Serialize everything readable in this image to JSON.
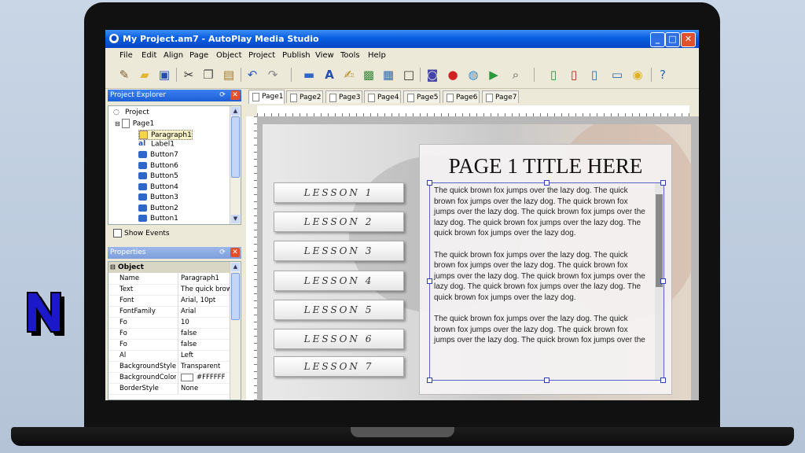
{
  "window": {
    "title": "My Project.am7 - AutoPlay Media Studio",
    "app_icon": "autoplay-logo-icon",
    "controls": [
      "minimize",
      "maximize",
      "close"
    ]
  },
  "menu": [
    "File",
    "Edit",
    "Align",
    "Page",
    "Object",
    "Project",
    "Publish",
    "View",
    "Tools",
    "Help"
  ],
  "toolbar": {
    "icons": [
      "wand-icon",
      "open-folder-icon",
      "save-icon",
      "cut-icon",
      "copy-icon",
      "paste-icon",
      "undo-icon",
      "redo-icon",
      "button-object-icon",
      "label-object-icon",
      "paragraph-object-icon",
      "image-object-icon",
      "grid-object-icon",
      "frame-object-icon",
      "video-object-icon",
      "flash-object-icon",
      "web-object-icon",
      "publish-icon",
      "search-icon",
      "add-page-icon",
      "page-icon",
      "page-preview-icon",
      "computer-icon",
      "cd-icon",
      "help-icon"
    ]
  },
  "project_explorer": {
    "title": "Project Explorer",
    "items": [
      {
        "label": "Project",
        "icon": "project-icon"
      },
      {
        "label": "Page1",
        "icon": "page-icon"
      },
      {
        "label": "Paragraph1",
        "icon": "paragraph-icon"
      },
      {
        "label": "Label1",
        "icon": "label-icon"
      },
      {
        "label": "Button7",
        "icon": "button-icon"
      },
      {
        "label": "Button6",
        "icon": "button-icon"
      },
      {
        "label": "Button5",
        "icon": "button-icon"
      },
      {
        "label": "Button4",
        "icon": "button-icon"
      },
      {
        "label": "Button3",
        "icon": "button-icon"
      },
      {
        "label": "Button2",
        "icon": "button-icon"
      },
      {
        "label": "Button1",
        "icon": "button-icon"
      }
    ],
    "show_events": "Show Events"
  },
  "properties": {
    "title": "Properties",
    "section": "Object",
    "rows": [
      {
        "key": "Name",
        "value": "Paragraph1"
      },
      {
        "key": "Text",
        "value": "The quick brown"
      },
      {
        "key": "Font",
        "value": "Arial, 10pt"
      },
      {
        "key": "FontFamily",
        "value": "Arial"
      },
      {
        "key": "Fo",
        "value": "10"
      },
      {
        "key": "Fo",
        "value": "false"
      },
      {
        "key": "Fo",
        "value": "false"
      },
      {
        "key": "Al",
        "value": "Left"
      },
      {
        "key": "BackgroundStyle",
        "value": "Transparent"
      },
      {
        "key": "BackgroundColor",
        "value": "#FFFFFF",
        "swatch": "#ffffff"
      },
      {
        "key": "BorderStyle",
        "value": "None"
      }
    ]
  },
  "tabs": [
    "Page1",
    "Page2",
    "Page3",
    "Page4",
    "Page5",
    "Page6",
    "Page7"
  ],
  "active_tab": "Page1",
  "canvas": {
    "lessons": [
      "LESSON 1",
      "LESSON 2",
      "LESSON 3",
      "LESSON 4",
      "LESSON 5",
      "LESSON 6",
      "LESSON 7"
    ],
    "page_title": "PAGE 1 TITLE HERE",
    "paragraphs": [
      "The quick brown fox jumps over the lazy dog. The quick brown fox jumps over the lazy dog. The quick brown fox jumps over the lazy dog. The quick brown fox jumps over the lazy dog. The quick brown fox jumps over the lazy dog. The quick brown fox jumps over the lazy dog.",
      "The quick brown fox jumps over the lazy dog. The quick brown fox jumps over the lazy dog. The quick brown fox jumps over the lazy dog. The quick brown fox jumps over the lazy dog. The quick brown fox jumps over the lazy dog. The quick brown fox jumps over the lazy dog.",
      "The quick brown fox jumps over the lazy dog. The quick brown fox jumps over the lazy dog. The quick brown fox jumps over the lazy dog. The quick brown fox jumps over the"
    ]
  },
  "colors": {
    "titlebar": "#0a5ee0",
    "panel_header": "#1d5fd6",
    "selection_border": "#5a64c8",
    "logo_fill": "#1a18c8"
  },
  "logo": {
    "letter": "N"
  }
}
